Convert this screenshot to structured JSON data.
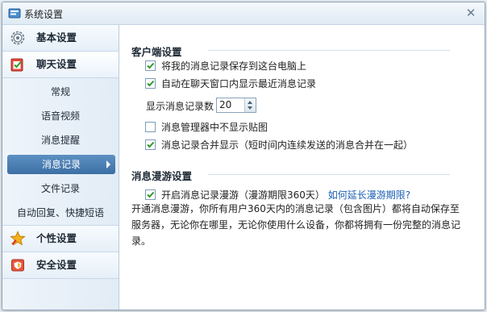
{
  "window": {
    "title": "系统设置",
    "close_icon": "close-icon"
  },
  "sidebar": {
    "categories": [
      {
        "label": "基本设置",
        "icon": "gear-icon"
      },
      {
        "label": "聊天设置",
        "icon": "chat-checklist-icon"
      },
      {
        "label": "个性设置",
        "icon": "star-icon"
      },
      {
        "label": "安全设置",
        "icon": "shield-icon"
      }
    ],
    "chat_items": [
      "常规",
      "语音视频",
      "消息提醒",
      "消息记录",
      "文件记录",
      "自动回复、快捷短语"
    ],
    "selected": "消息记录"
  },
  "client": {
    "title": "客户端设置",
    "save_local": {
      "label": "将我的消息记录保存到这台电脑上",
      "checked": true
    },
    "auto_show": {
      "label": "自动在聊天窗口内显示最近消息记录",
      "checked": true
    },
    "count_label": "显示消息记录数",
    "count_value": "20",
    "hide_stickers": {
      "label": "消息管理器中不显示贴图",
      "checked": false
    },
    "merge": {
      "label": "消息记录合并显示（短时间内连续发送的消息合并在一起）",
      "checked": true
    }
  },
  "roaming": {
    "title": "消息漫游设置",
    "enable": {
      "label": "开启消息记录漫游（漫游期限360天）",
      "checked": true
    },
    "extend_link": "如何延长漫游期限?",
    "description": "开通消息漫游，你所有用户360天内的消息记录（包含图片）都将自动保存至服务器，无论你在哪里，无论你使用什么设备，你都将拥有一份完整的消息记录。"
  },
  "colors": {
    "accent": "#3c6fa4",
    "link": "#1a5fb4",
    "check": "#2e9a2e"
  }
}
